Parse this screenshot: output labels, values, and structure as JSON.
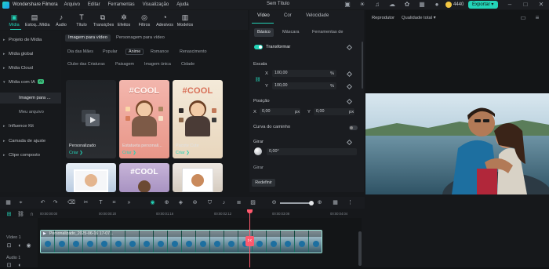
{
  "titlebar": {
    "app_name": "Wondershare Filmora",
    "menus": [
      "Arquivo",
      "Editar",
      "Ferramentas",
      "Visualização",
      "Ajuda"
    ],
    "title": "Sem Título",
    "credits": "4440",
    "export_label": "Exportar"
  },
  "toolbar": {
    "tools": [
      {
        "label": "Mídia",
        "icon": "media-icon"
      },
      {
        "label": "Estoq...Mídia",
        "icon": "stock-media-icon"
      },
      {
        "label": "Áudio",
        "icon": "audio-icon"
      },
      {
        "label": "Título",
        "icon": "title-icon"
      },
      {
        "label": "Transições",
        "icon": "transitions-icon"
      },
      {
        "label": "Efeitos",
        "icon": "effects-icon"
      },
      {
        "label": "Filtros",
        "icon": "filters-icon"
      },
      {
        "label": "Adesivos",
        "icon": "stickers-icon"
      },
      {
        "label": "Modelos",
        "icon": "templates-icon"
      }
    ]
  },
  "library": {
    "items": [
      {
        "label": "Projeto de Mídia"
      },
      {
        "label": "Mídia global"
      },
      {
        "label": "Mídia Cloud"
      },
      {
        "label": "Mídia com IA",
        "badge": "AI"
      },
      {
        "label": "Imagem para ..."
      },
      {
        "label": "Meu arquivo"
      },
      {
        "label": "Influence Kit"
      },
      {
        "label": "Camada de ajuste"
      },
      {
        "label": "Clipe composto"
      }
    ]
  },
  "content": {
    "tabs": [
      "Imagem para vídeo",
      "Personagem para vídeo"
    ],
    "chips_row1": [
      "Dia das Mães",
      "Popular",
      "Anime",
      "Romance",
      "Renascimento"
    ],
    "chips_row2": [
      "Clube das Criaturas",
      "Paisagem",
      "Imagem única",
      "Cidade"
    ],
    "cards": [
      {
        "caption": "Personalizado",
        "create": "Criar ❯"
      },
      {
        "caption": "Estatueta personali...",
        "create": "Criar ❯",
        "cool": "#COOL"
      },
      {
        "caption": "Pacote Cute",
        "create": "Criar ❯",
        "cool": "#COOL"
      },
      {
        "caption": "",
        "create": "",
        "cool": ""
      },
      {
        "caption": "",
        "create": "",
        "cool": "#COOL"
      },
      {
        "caption": "",
        "create": "",
        "cool": ""
      }
    ]
  },
  "properties": {
    "tabs": [
      "Vídeo",
      "Cor",
      "Velocidade"
    ],
    "subtabs": [
      "Básico",
      "Máscara",
      "Ferramentas de"
    ],
    "transform_label": "Transformar",
    "scale_label": "Escala",
    "x_label": "X",
    "y_label": "Y",
    "scale_x": "100,00",
    "scale_y": "100,00",
    "percent": "%",
    "position_label": "Posição",
    "pos_x": "0,00",
    "pos_y": "0,00",
    "px": "px",
    "path_curve_label": "Curva do caminho",
    "rotate_label": "Girar",
    "rotate_value": "0,00°",
    "flip_label": "Girar",
    "reset_label": "Redefinir"
  },
  "player": {
    "label": "Reprodutor",
    "quality": "Qualidade total"
  },
  "timeline": {
    "ruler_ticks": [
      "00:00:00:00",
      "00:00:00:20",
      "00:00:01:16",
      "00:00:02:12",
      "00:00:03:08",
      "00:00:04:04"
    ],
    "video_track_label": "Vídeo 1",
    "audio_track_label": "Áudio 1",
    "clip_name": "Personalizado_2025-06-16 17-07..."
  },
  "colors": {
    "accent": "#23d3b7",
    "playhead": "#ff5a6e",
    "clip": "#1e6d62"
  }
}
